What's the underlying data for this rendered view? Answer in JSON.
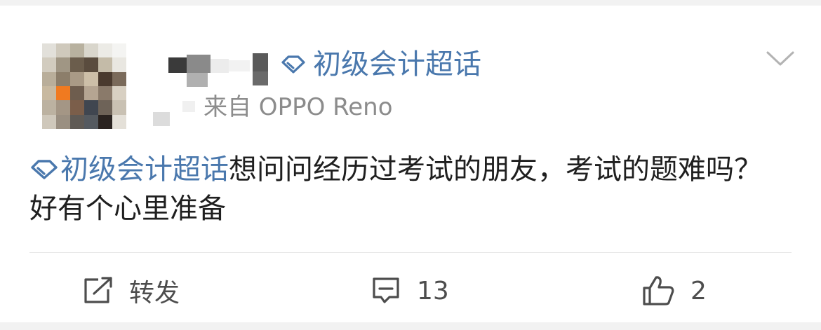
{
  "post": {
    "topic_chip": "初级会计超话",
    "source": "来自 OPPO Reno",
    "topic_link": "初级会计超话",
    "body_text": "想问问经历过考试的朋友，考试的题难吗？好有个心里准备"
  },
  "actions": {
    "repost_label": "转发",
    "comment_count": "13",
    "like_count": "2"
  },
  "icons": {
    "topic": "supertopic-diamond-icon",
    "more": "chevron-down-icon",
    "repost": "share-icon",
    "comment": "comment-icon",
    "like": "thumbs-up-icon"
  },
  "colors": {
    "accent": "#4a78ad",
    "text": "#1f1f1f",
    "secondary_text": "#8c8c8c",
    "action_text": "#4d4d4d"
  }
}
